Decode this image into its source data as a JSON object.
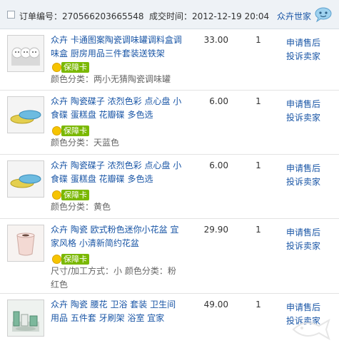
{
  "header": {
    "order_label": "订单编号：",
    "order_no": "270566203665548",
    "time_label": "成交时间：",
    "time": "2012-12-19 20:04",
    "shop_name": "众卉世家"
  },
  "colors": {
    "link": "#1a56a6",
    "header_bg": "#eef2f6",
    "badge_green": "#7ab800",
    "badge_yellow": "#f6c400"
  },
  "items": [
    {
      "title": "众卉 卡通图案陶瓷调味罐调料盒调味盒 厨房用品三件套装送铁架",
      "badge": "保障卡",
      "attr": "颜色分类：两小无猜陶瓷调味罐",
      "price": "33.00",
      "qty": "1",
      "action_refund": "申请售后",
      "action_complain": "投诉卖家"
    },
    {
      "title": "众卉 陶瓷碟子 浓烈色彩 点心盘 小食碟 蛋糕盘 花瓣碟 多色选",
      "badge": "保障卡",
      "attr": "颜色分类：天蓝色",
      "price": "6.00",
      "qty": "1",
      "action_refund": "申请售后",
      "action_complain": "投诉卖家"
    },
    {
      "title": "众卉 陶瓷碟子 浓烈色彩 点心盘 小食碟 蛋糕盘 花瓣碟 多色选",
      "badge": "保障卡",
      "attr": "颜色分类：黄色",
      "price": "6.00",
      "qty": "1",
      "action_refund": "申请售后",
      "action_complain": "投诉卖家"
    },
    {
      "title": "众卉 陶瓷 欧式粉色迷你小花盆 宜家风格 小清新简约花盆",
      "badge": "保障卡",
      "attr": "尺寸/加工方式：小 颜色分类：粉红色",
      "price": "29.90",
      "qty": "1",
      "action_refund": "申请售后",
      "action_complain": "投诉卖家"
    },
    {
      "title": "众卉 陶瓷 腰花 卫浴 套装 卫生间用品 五件套 牙刷架 浴室 宜家",
      "price": "49.00",
      "qty": "1",
      "action_refund": "申请售后",
      "action_complain": "投诉卖家"
    }
  ]
}
